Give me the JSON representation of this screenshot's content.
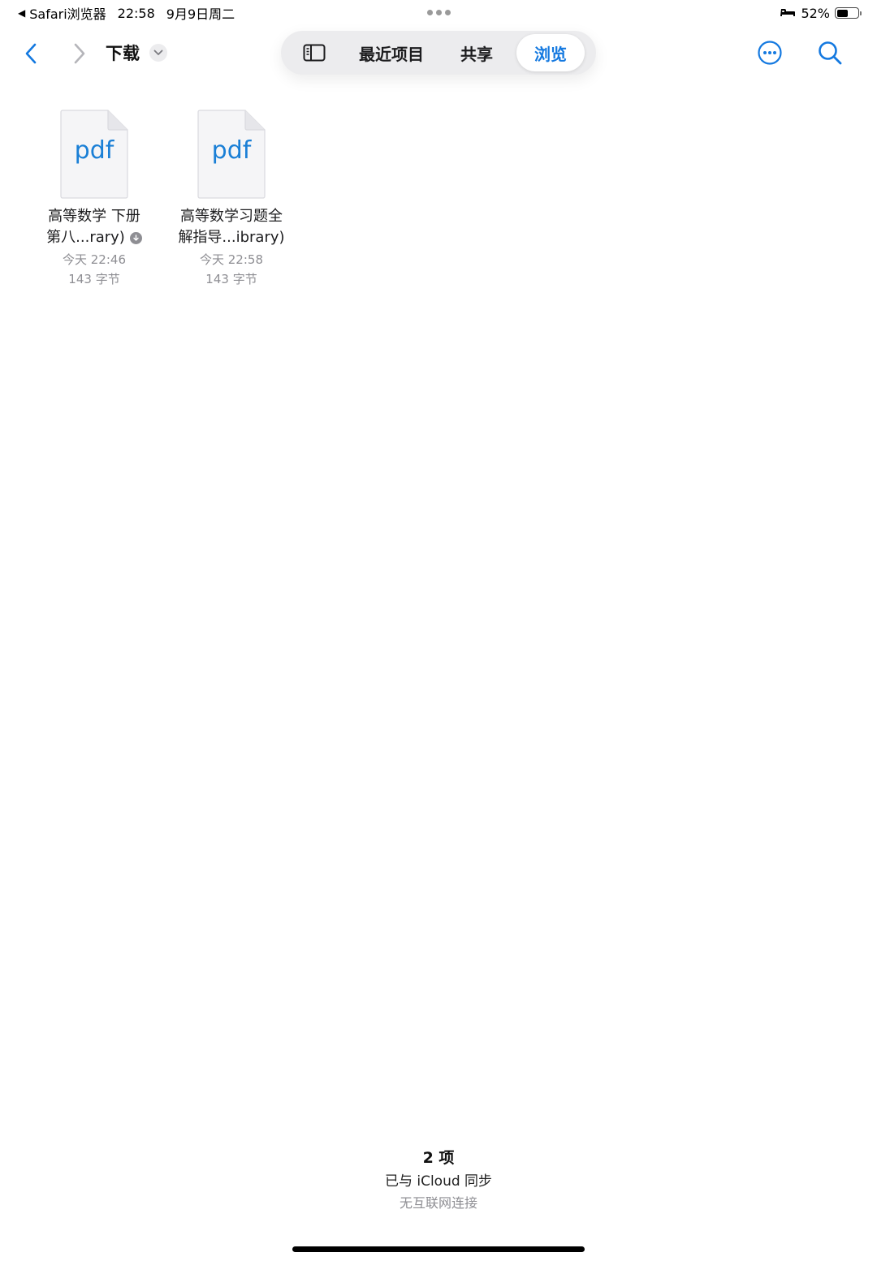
{
  "status_bar": {
    "back_app": "Safari浏览器",
    "time": "22:58",
    "date": "9月9日周二",
    "battery": "52%"
  },
  "nav": {
    "folder_title": "下载"
  },
  "tabs": [
    {
      "label": "最近项目"
    },
    {
      "label": "共享"
    },
    {
      "label": "浏览",
      "selected": true
    }
  ],
  "files": [
    {
      "ext": "pdf",
      "name_line1": "高等数学 下册",
      "name_line2": "第八...rary)",
      "date": "今天 22:46",
      "size": "143 字节"
    },
    {
      "ext": "pdf",
      "name_line1": "高等数学习题全",
      "name_line2": "解指导...ibrary)",
      "date": "今天 22:58",
      "size": "143 字节"
    }
  ],
  "footer": {
    "count": "2 项",
    "sync": "已与 iCloud 同步",
    "network": "无互联网连接"
  },
  "colors": {
    "accent": "#1479e0",
    "pdf_text": "#1a7fd6",
    "secondary_text": "#8e8e93"
  }
}
